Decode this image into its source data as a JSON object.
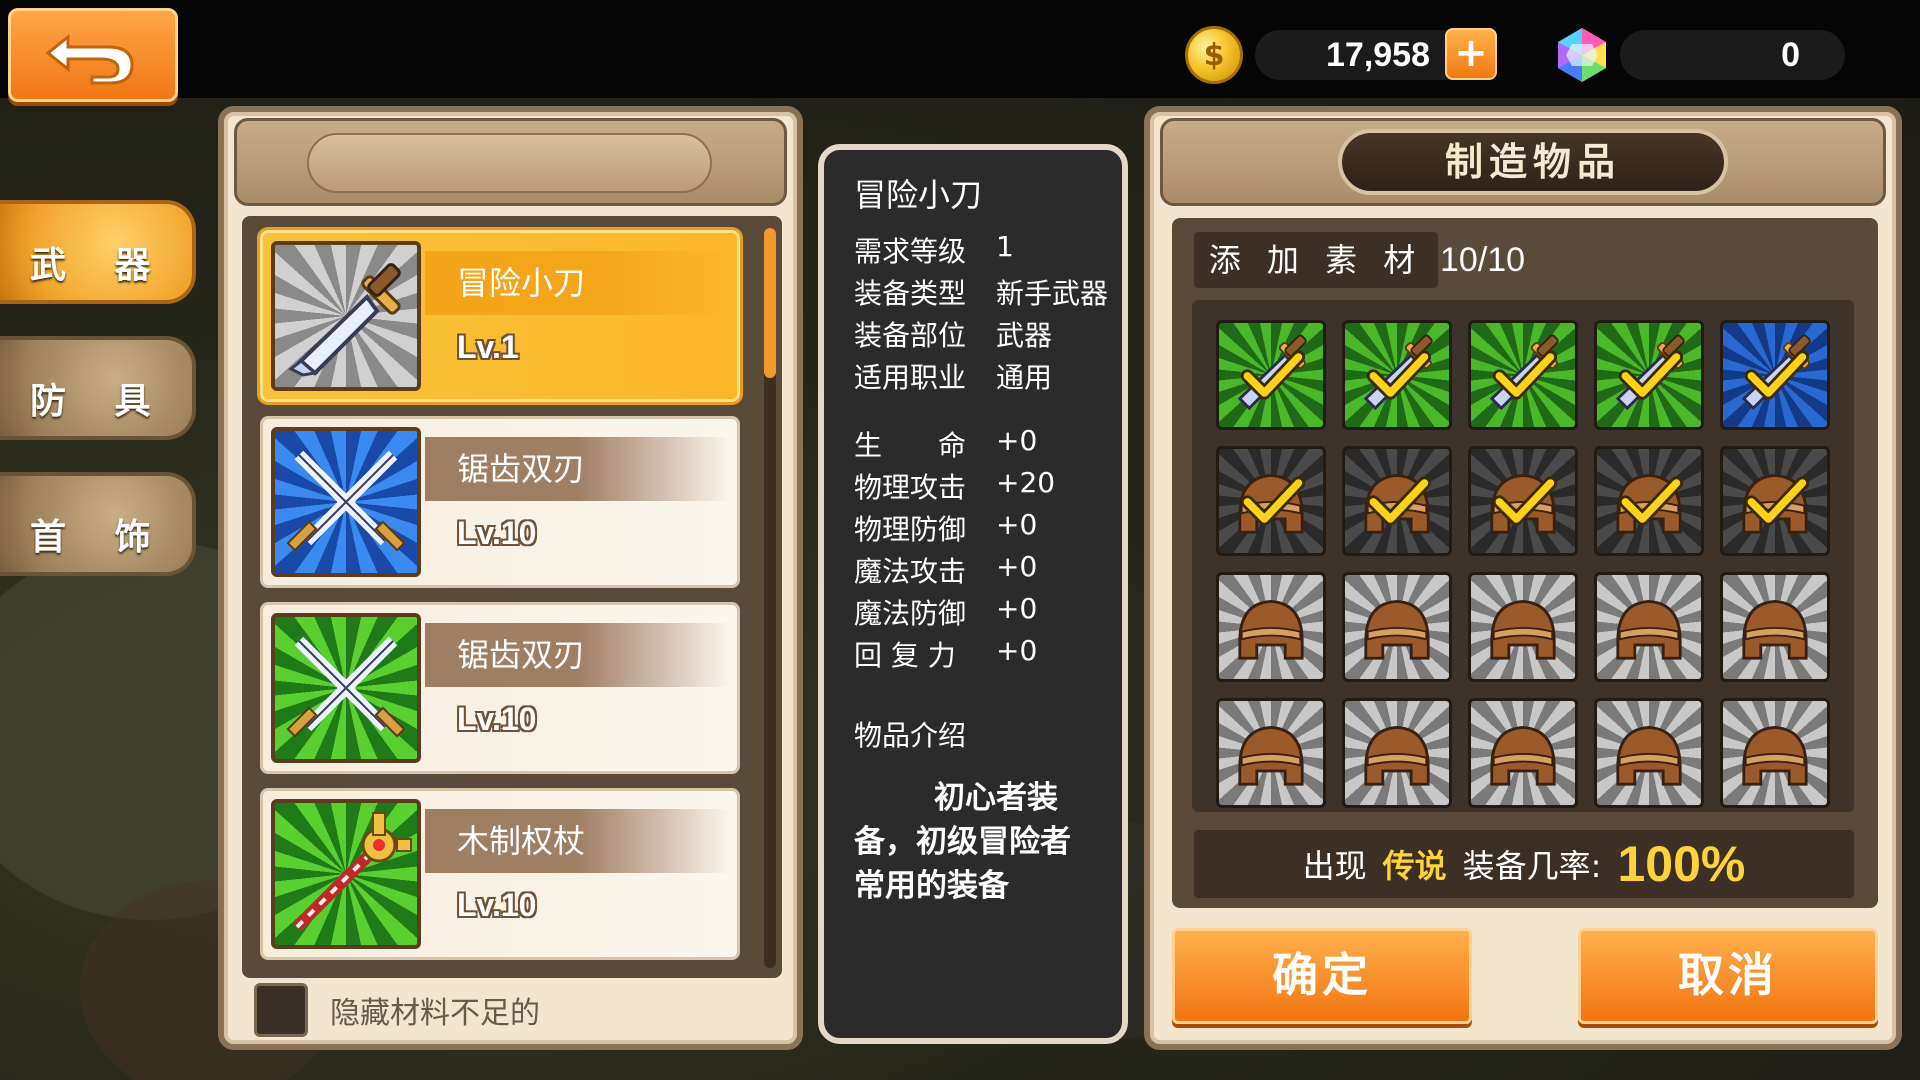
{
  "top_bar": {
    "gold": "17,958",
    "gems": "0",
    "coin_icon": "coin-icon",
    "gem_icon": "rainbow-gem-icon",
    "back_icon": "back-arrow-icon"
  },
  "categories": [
    {
      "label": "武 器",
      "active": true
    },
    {
      "label": "防 具",
      "active": false
    },
    {
      "label": "首 饰",
      "active": false
    }
  ],
  "list": {
    "items": [
      {
        "name": "冒险小刀",
        "level": "Lv.1",
        "icon": "dagger-icon",
        "bg": "gray",
        "selected": true
      },
      {
        "name": "锯齿双刃",
        "level": "Lv.10",
        "icon": "crossed-swords-icon",
        "bg": "blue",
        "selected": false
      },
      {
        "name": "锯齿双刃",
        "level": "Lv.10",
        "icon": "crossed-swords-icon",
        "bg": "green",
        "selected": false
      },
      {
        "name": "木制权杖",
        "level": "Lv.10",
        "icon": "wooden-scepter-icon",
        "bg": "green",
        "selected": false
      }
    ],
    "hide_label": "隐藏材料不足的"
  },
  "info": {
    "title": "冒险小刀",
    "attrs": [
      {
        "k": "需求等级",
        "v": "1"
      },
      {
        "k": "装备类型",
        "v": "新手武器"
      },
      {
        "k": "装备部位",
        "v": "武器"
      },
      {
        "k": "适用职业",
        "v": "通用"
      }
    ],
    "stats": [
      {
        "k": "生　　命",
        "v": "+0"
      },
      {
        "k": "物理攻击",
        "v": "+20"
      },
      {
        "k": "物理防御",
        "v": "+0"
      },
      {
        "k": "魔法攻击",
        "v": "+0"
      },
      {
        "k": "魔法防御",
        "v": "+0"
      },
      {
        "k": "回 复 力",
        "v": "+0"
      }
    ],
    "desc_title": "物品介绍",
    "desc": "初心者装备，初级冒险者常用的装备"
  },
  "craft": {
    "title": "制造物品",
    "add_label": "添 加 素 材",
    "count": "10/10",
    "materials": [
      {
        "kind": "dagger",
        "bg": "green",
        "checked": true
      },
      {
        "kind": "dagger",
        "bg": "green",
        "checked": true
      },
      {
        "kind": "dagger",
        "bg": "green",
        "checked": true
      },
      {
        "kind": "dagger",
        "bg": "green",
        "checked": true
      },
      {
        "kind": "dagger",
        "bg": "blue",
        "checked": true
      },
      {
        "kind": "helmet",
        "bg": "gray-dark",
        "checked": true
      },
      {
        "kind": "helmet",
        "bg": "gray-dark",
        "checked": true
      },
      {
        "kind": "helmet",
        "bg": "gray-dark",
        "checked": true
      },
      {
        "kind": "helmet",
        "bg": "gray-dark",
        "checked": true
      },
      {
        "kind": "helmet",
        "bg": "gray-dark",
        "checked": true
      },
      {
        "kind": "helmet",
        "bg": "gray",
        "checked": false
      },
      {
        "kind": "helmet",
        "bg": "gray",
        "checked": false
      },
      {
        "kind": "helmet",
        "bg": "gray",
        "checked": false
      },
      {
        "kind": "helmet",
        "bg": "gray",
        "checked": false
      },
      {
        "kind": "helmet",
        "bg": "gray",
        "checked": false
      },
      {
        "kind": "helmet",
        "bg": "gray",
        "checked": false
      },
      {
        "kind": "helmet",
        "bg": "gray",
        "checked": false
      },
      {
        "kind": "helmet",
        "bg": "gray",
        "checked": false
      },
      {
        "kind": "helmet",
        "bg": "gray",
        "checked": false
      },
      {
        "kind": "helmet",
        "bg": "gray",
        "checked": false
      }
    ],
    "rate_prefix": "出现",
    "rate_grade": "传说",
    "rate_middle": "装备几率:",
    "rate_value": "100%",
    "confirm": "确定",
    "cancel": "取消"
  },
  "colors": {
    "accent_orange": "#f27512",
    "gold_text": "#ffd23c",
    "panel_bg": "#f2e6cf",
    "panel_border": "#8a7256"
  }
}
